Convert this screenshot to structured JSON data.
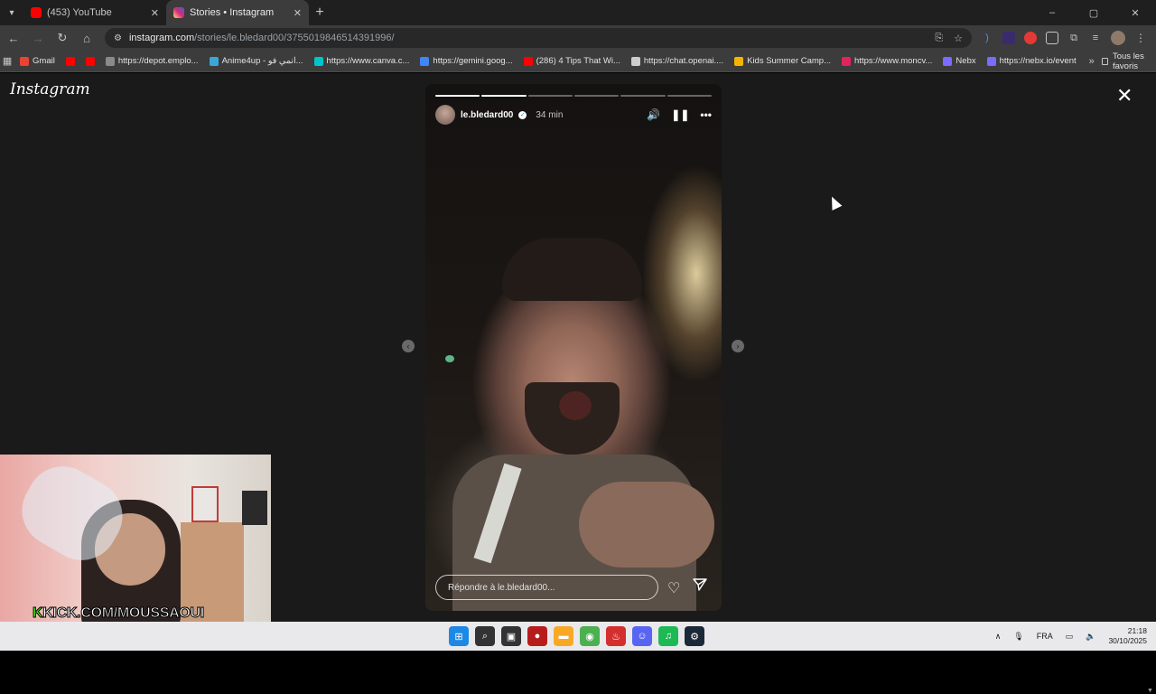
{
  "browser": {
    "tabs": [
      {
        "title": "(453) YouTube",
        "active": false,
        "favicon_color": "#ff0000"
      },
      {
        "title": "Stories • Instagram",
        "active": true,
        "favicon_color": "#d62976",
        "audio": true
      }
    ],
    "window_controls": [
      "–",
      "▢",
      "✕"
    ],
    "url_host": "instagram.com",
    "url_path": "/stories/le.bledard00/3755019846514391996/",
    "bookmarks": [
      {
        "label": "Gmail",
        "color": "#ea4335"
      },
      {
        "label": "",
        "color": "#ff0000"
      },
      {
        "label": "",
        "color": "#ff0000"
      },
      {
        "label": "https://depot.emplo...",
        "color": "#8a8a8a"
      },
      {
        "label": "Anime4up - انمي فو...",
        "color": "#3aa7d8"
      },
      {
        "label": "https://www.canva.c...",
        "color": "#00c4cc"
      },
      {
        "label": "https://gemini.goog...",
        "color": "#4285f4"
      },
      {
        "label": "(286) 4 Tips That Wi...",
        "color": "#ff0000"
      },
      {
        "label": "https://chat.openai....",
        "color": "#cccccc"
      },
      {
        "label": "Kids Summer Camp...",
        "color": "#f5b400"
      },
      {
        "label": "https://www.moncv...",
        "color": "#e0245e"
      },
      {
        "label": "Nebx",
        "color": "#7a6cff"
      },
      {
        "label": "https://nebx.io/event",
        "color": "#7a6cff"
      }
    ],
    "all_bookmarks_label": "Tous les favoris"
  },
  "instagram": {
    "logo": "Instagram",
    "story": {
      "username": "le.bledard00",
      "time_ago": "34 min",
      "segments_total": 6,
      "segments_done": 2,
      "reply_placeholder": "Répondre à le.bledard00..."
    }
  },
  "overlay": {
    "stream_tag_k": "K",
    "stream_tag_rest": "KICK.COM/MOUSSAOUI"
  },
  "taskbar": {
    "language": "FRA",
    "time": "21:18",
    "date": "30/10/2025",
    "apps": [
      {
        "name": "start",
        "color": "#1e88e5"
      },
      {
        "name": "search",
        "color": "#333333"
      },
      {
        "name": "task-view",
        "color": "#333333"
      },
      {
        "name": "app-red",
        "color": "#b71c1c"
      },
      {
        "name": "file-explorer",
        "color": "#f9a825"
      },
      {
        "name": "chrome",
        "color": "#4caf50"
      },
      {
        "name": "app-flame",
        "color": "#d32f2f"
      },
      {
        "name": "discord",
        "color": "#5865f2"
      },
      {
        "name": "spotify",
        "color": "#1db954"
      },
      {
        "name": "steam",
        "color": "#1b2838"
      }
    ]
  }
}
